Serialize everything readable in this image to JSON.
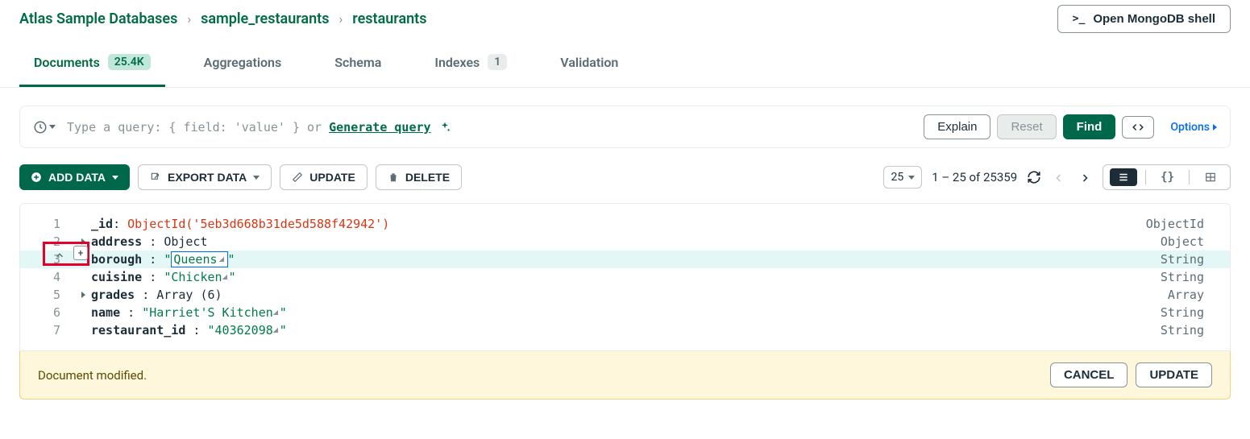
{
  "breadcrumb": [
    "Atlas Sample Databases",
    "sample_restaurants",
    "restaurants"
  ],
  "shell_btn": "Open MongoDB shell",
  "tabs": [
    {
      "label": "Documents",
      "badge": "25.4K",
      "active": true
    },
    {
      "label": "Aggregations"
    },
    {
      "label": "Schema"
    },
    {
      "label": "Indexes",
      "badge": "1"
    },
    {
      "label": "Validation"
    }
  ],
  "query": {
    "placeholder_pre": "Type a query: { field: 'value' } or ",
    "generate": "Generate query",
    "explain": "Explain",
    "reset": "Reset",
    "find": "Find",
    "options": "Options"
  },
  "toolbar": {
    "add": "ADD DATA",
    "export": "EXPORT DATA",
    "update": "UPDATE",
    "delete": "DELETE",
    "page_size": "25",
    "page_info": "1 – 25 of 25359"
  },
  "doc": {
    "lines": [
      {
        "n": "1",
        "key": "_id",
        "val_raw": "ObjectId('5eb3d668b31de5d588f42942')",
        "type": "ObjectId",
        "kind": "oid"
      },
      {
        "n": "2",
        "key": "address",
        "val_raw": "Object",
        "type": "Object",
        "kind": "obj",
        "expand": true
      },
      {
        "n": "3",
        "key": "borough",
        "val_raw": "Queens",
        "type": "String",
        "kind": "str",
        "editing": true
      },
      {
        "n": "4",
        "key": "cuisine",
        "val_raw": "Chicken",
        "type": "String",
        "kind": "str",
        "resize": true
      },
      {
        "n": "5",
        "key": "grades",
        "val_raw": "Array (6)",
        "type": "Array",
        "kind": "obj",
        "expand": true
      },
      {
        "n": "6",
        "key": "name",
        "val_raw": "Harriet'S Kitchen",
        "type": "String",
        "kind": "str",
        "resize": true
      },
      {
        "n": "7",
        "key": "restaurant_id",
        "val_raw": "40362098",
        "type": "String",
        "kind": "str",
        "resize": true
      }
    ]
  },
  "footer": {
    "msg": "Document modified.",
    "cancel": "CANCEL",
    "update": "UPDATE"
  }
}
